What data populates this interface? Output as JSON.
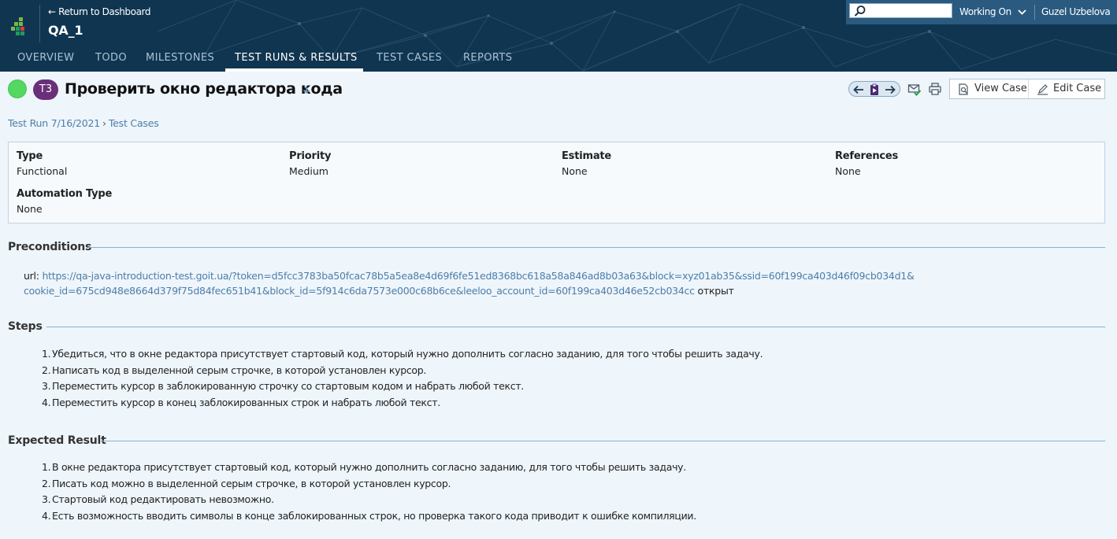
{
  "header": {
    "return_link": "← Return to Dashboard",
    "project": "QA_1",
    "working_on": "Working On",
    "user": "Guzel Uzbelova",
    "search_placeholder": ""
  },
  "tabs": [
    {
      "label": "OVERVIEW"
    },
    {
      "label": "TODO"
    },
    {
      "label": "MILESTONES"
    },
    {
      "label": "TEST RUNS & RESULTS"
    },
    {
      "label": "TEST CASES"
    },
    {
      "label": "REPORTS"
    }
  ],
  "case": {
    "status_color": "#54d85f",
    "badge": "T3",
    "title": "Проверить окно редактора кода",
    "view_case": "View Case",
    "edit_case": "Edit Case"
  },
  "breadcrumb": {
    "run": "Test Run 7/16/2021",
    "sep": "›",
    "cases": "Test Cases"
  },
  "fields": {
    "type_label": "Type",
    "type_value": "Functional",
    "priority_label": "Priority",
    "priority_value": "Medium",
    "estimate_label": "Estimate",
    "estimate_value": "None",
    "references_label": "References",
    "references_value": "None",
    "automation_label": "Automation Type",
    "automation_value": "None"
  },
  "preconditions": {
    "heading": "Preconditions",
    "prefix": "url:",
    "url_line1": "https://qa-java-introduction-test.goit.ua/?token=d5fcc3783ba50fcac78b5a5ea8e4d69f6fe51ed8368bc618a58a846ad8b03a63&block=xyz01ab35&ssid=60f199ca403d46f09cb034d1&",
    "url_line2": "cookie_id=675cd948e8664d379f75d84fec651b41&block_id=5f914c6da7573e000c68b6ce&leeloo_account_id=60f199ca403d46e52cb034cc",
    "suffix": "открыт"
  },
  "steps": {
    "heading": "Steps",
    "items": [
      "Убедиться, что в окне редактора присутствует стартовый код, который нужно дополнить согласно заданию, для того чтобы решить задачу.",
      "Написать код в выделенной серым строчке, в которой установлен курсор.",
      "Переместить курсор в заблокированную строчку со стартовым кодом и набрать любой текст.",
      "Переместить курсор в конец заблокированных строк и набрать любой текст."
    ]
  },
  "expected": {
    "heading": "Expected Result",
    "items": [
      "В окне редактора присутствует стартовый код, который нужно дополнить согласно заданию, для того чтобы решить задачу.",
      "Писать код можно в выделенной серым строчке, в которой установлен курсор.",
      "Стартовый код редактировать невозможно.",
      "Есть возможность вводить символы в конце заблокированных строк, но проверка такого кода приводит к ошибке компиляции."
    ]
  },
  "icons": {
    "search": "search-icon",
    "chevron": "chevron-down-icon",
    "prev": "arrow-left-icon",
    "clipboard": "clipboard-icon",
    "next": "arrow-right-icon",
    "mail": "mail-check-icon",
    "print": "printer-icon",
    "view": "view-case-icon",
    "edit": "pencil-icon"
  }
}
